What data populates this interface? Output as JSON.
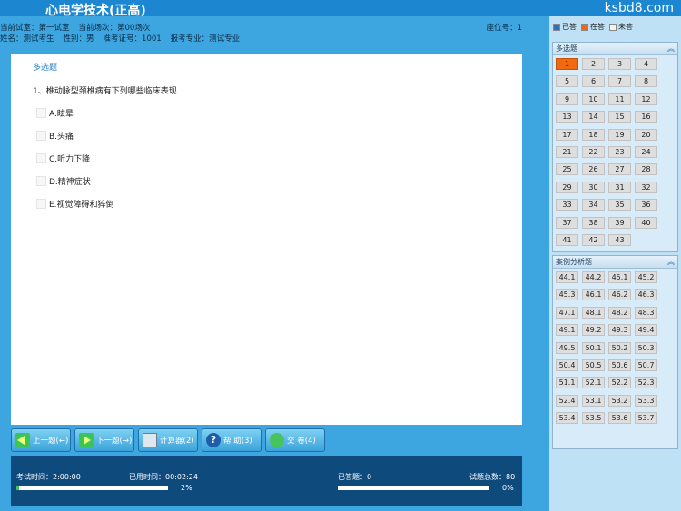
{
  "header": {
    "title": "心电学技术(正高)",
    "watermark": "ksbd8.com"
  },
  "exam_info": {
    "room": "当前试室：第一试室",
    "session": "当前场次：第00场次",
    "seat": "座位号：1",
    "name": "姓名：测试考生",
    "gender": "性别：男",
    "ticket": "准考证号：1001",
    "major": "报考专业：测试专业"
  },
  "question": {
    "section": "多选题",
    "text": "1、椎动脉型颈椎病有下列哪些临床表现",
    "options": [
      "A.眩晕",
      "B.头痛",
      "C.听力下降",
      "D.精神症状",
      "E.视觉障碍和猝倒"
    ]
  },
  "buttons": {
    "prev": "上一题(←)",
    "next": "下一题(→)",
    "calc": "计算器(2)",
    "help": "帮 助(3)",
    "submit": "交 卷(4)"
  },
  "status": {
    "exam_time": "考试时间：2:00:00",
    "used_time": "已用时间：00:02:24",
    "time_percent": 2,
    "time_percent_label": "2%",
    "answered": "已答题：0",
    "total": "试题总数：80",
    "answered_percent": 0,
    "answered_percent_label": "0%"
  },
  "legend": {
    "answered": "已答",
    "current": "在答",
    "unanswered": "未答",
    "colors": {
      "answered": "#2f6fbf",
      "current": "#f16a12",
      "unanswered": "#f2f2f2"
    }
  },
  "sidebar": {
    "multi": {
      "title": "多选题",
      "items": [
        "1",
        "2",
        "3",
        "4",
        "5",
        "6",
        "7",
        "8",
        "9",
        "10",
        "11",
        "12",
        "13",
        "14",
        "15",
        "16",
        "17",
        "18",
        "19",
        "20",
        "21",
        "22",
        "23",
        "24",
        "25",
        "26",
        "27",
        "28",
        "29",
        "30",
        "31",
        "32",
        "33",
        "34",
        "35",
        "36",
        "37",
        "38",
        "39",
        "40",
        "41",
        "42",
        "43"
      ],
      "current": "1"
    },
    "case": {
      "title": "案例分析题",
      "items": [
        "44.1",
        "44.2",
        "45.1",
        "45.2",
        "45.3",
        "46.1",
        "46.2",
        "46.3",
        "47.1",
        "48.1",
        "48.2",
        "48.3",
        "49.1",
        "49.2",
        "49.3",
        "49.4",
        "49.5",
        "50.1",
        "50.2",
        "50.3",
        "50.4",
        "50.5",
        "50.6",
        "50.7",
        "51.1",
        "52.1",
        "52.2",
        "52.3",
        "52.4",
        "53.1",
        "53.2",
        "53.3",
        "53.4",
        "53.5",
        "53.6",
        "53.7"
      ]
    }
  }
}
